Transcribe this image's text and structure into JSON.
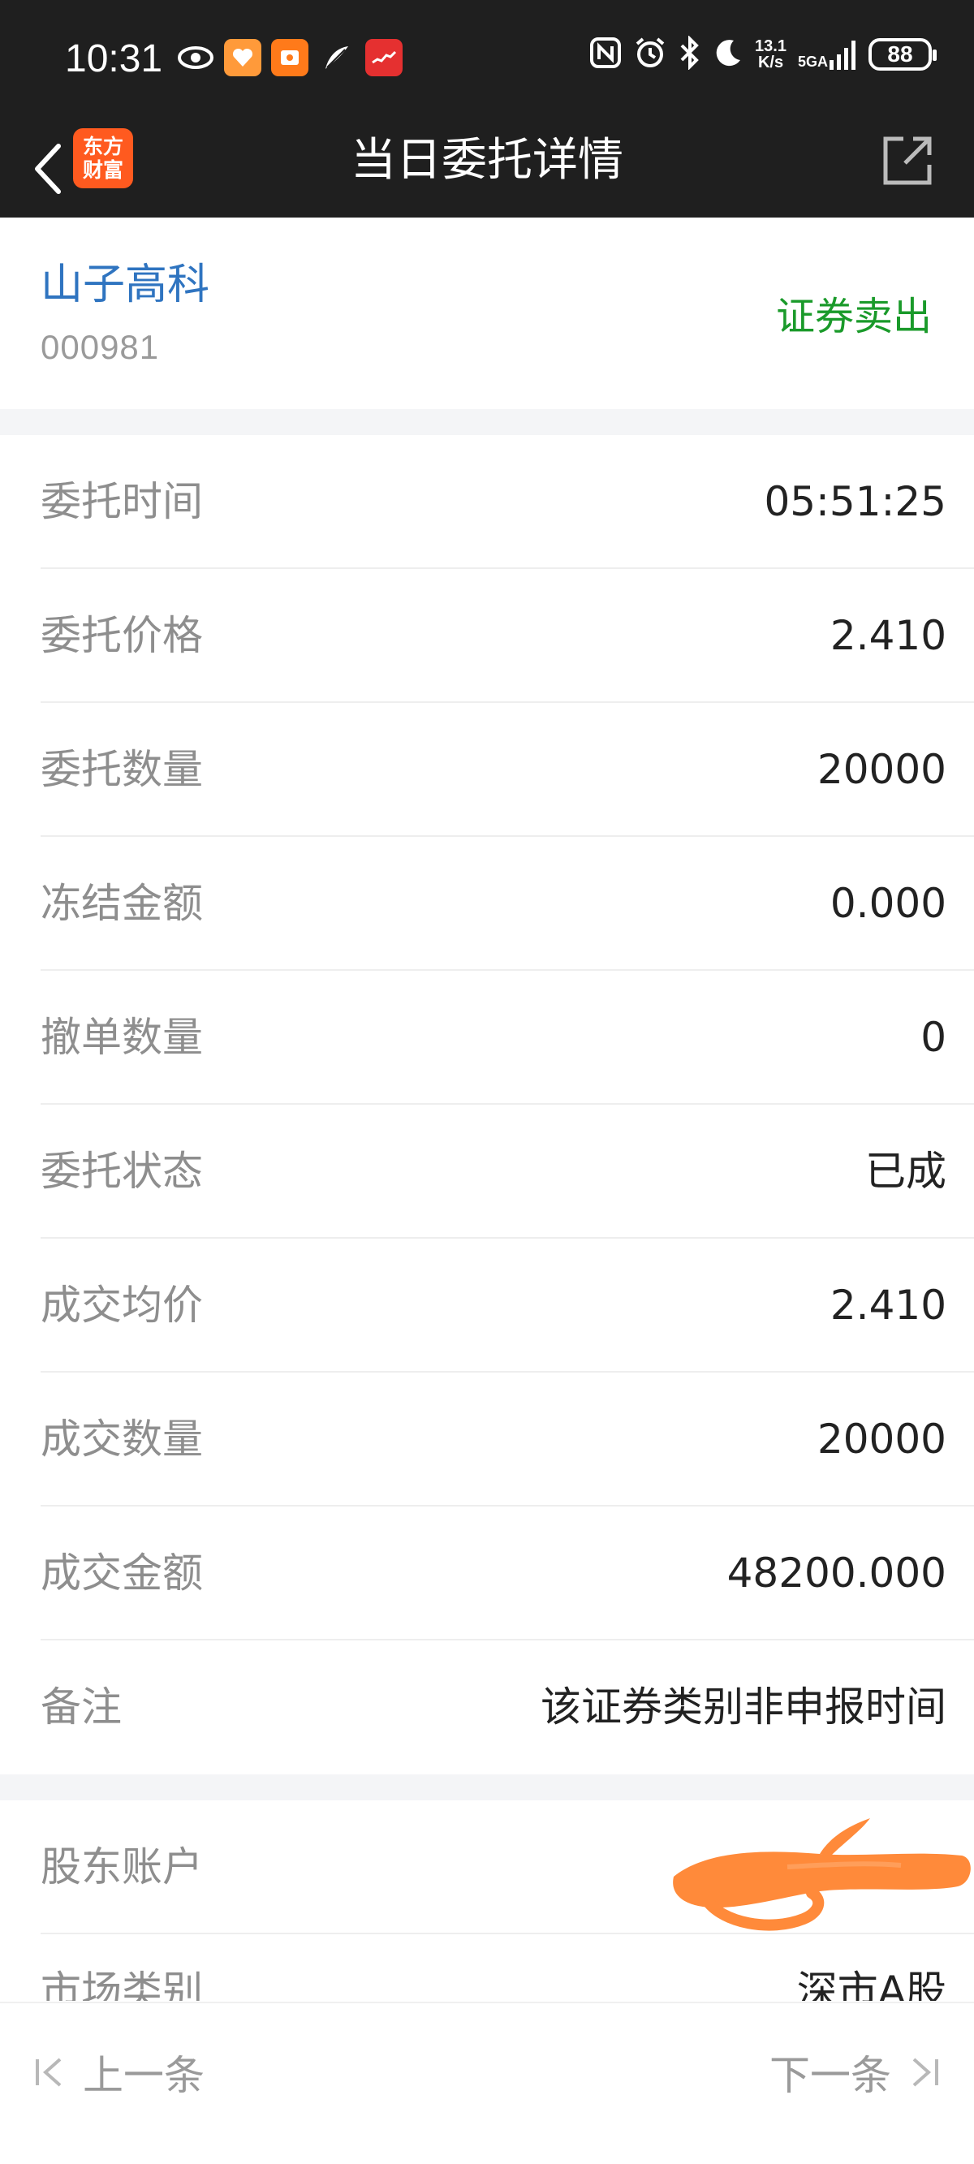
{
  "status_bar": {
    "time": "10:31",
    "net_speed_value": "13.1",
    "net_speed_unit": "K/s",
    "network": "5GA",
    "battery": "88"
  },
  "nav": {
    "logo_line1": "东方",
    "logo_line2": "财富",
    "title": "当日委托详情"
  },
  "stock": {
    "name": "山子高科",
    "code": "000981",
    "trade_type": "证券卖出"
  },
  "details": [
    {
      "label": "委托时间",
      "value": "05:51:25"
    },
    {
      "label": "委托价格",
      "value": "2.410"
    },
    {
      "label": "委托数量",
      "value": "20000"
    },
    {
      "label": "冻结金额",
      "value": "0.000"
    },
    {
      "label": "撤单数量",
      "value": "0"
    },
    {
      "label": "委托状态",
      "value": "已成"
    },
    {
      "label": "成交均价",
      "value": "2.410"
    },
    {
      "label": "成交数量",
      "value": "20000"
    },
    {
      "label": "成交金额",
      "value": "48200.000"
    },
    {
      "label": "备注",
      "value": "该证券类别非申报时间"
    }
  ],
  "account": {
    "label": "股东账户",
    "value": ""
  },
  "market": {
    "label": "市场类别",
    "value": "深市A股"
  },
  "bottom": {
    "prev": "上一条",
    "next": "下一条"
  },
  "colors": {
    "stock_name": "#2f74c0",
    "trade_type": "#1a9a2a",
    "redaction": "#ff8a3a",
    "logo": "#ff5a1f"
  }
}
